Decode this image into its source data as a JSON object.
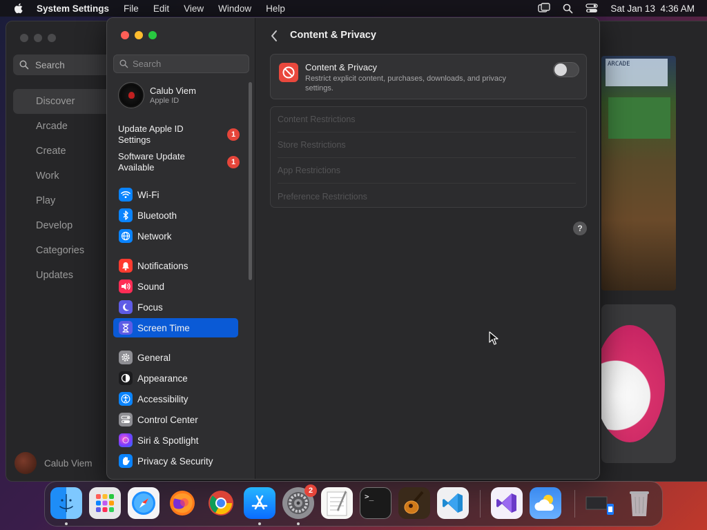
{
  "menubar": {
    "app_name": "System Settings",
    "menus": [
      "File",
      "Edit",
      "View",
      "Window",
      "Help"
    ],
    "datetime": "Sat Jan 13  4:36 AM"
  },
  "appstore": {
    "search_placeholder": "Search",
    "nav": [
      "Discover",
      "Arcade",
      "Create",
      "Work",
      "Play",
      "Develop",
      "Categories",
      "Updates"
    ],
    "active_nav": "Discover",
    "user_name": "Calub Viem",
    "art_sign": "ARCADE"
  },
  "settings": {
    "search_placeholder": "Search",
    "profile": {
      "name": "Calub Viem",
      "subtitle": "Apple ID"
    },
    "alerts": [
      {
        "label_line1": "Update Apple ID",
        "label_line2": "Settings",
        "count": "1"
      },
      {
        "label_line1": "Software Update",
        "label_line2": "Available",
        "count": "1"
      }
    ],
    "groups": [
      [
        {
          "label": "Wi-Fi",
          "icon": "wifi-icon",
          "color": "#0a84ff"
        },
        {
          "label": "Bluetooth",
          "icon": "bluetooth-icon",
          "color": "#0a84ff"
        },
        {
          "label": "Network",
          "icon": "globe-icon",
          "color": "#0a84ff"
        }
      ],
      [
        {
          "label": "Notifications",
          "icon": "bell-icon",
          "color": "#ff3b30"
        },
        {
          "label": "Sound",
          "icon": "speaker-icon",
          "color": "#ff2d55"
        },
        {
          "label": "Focus",
          "icon": "moon-icon",
          "color": "#5e5ce6"
        },
        {
          "label": "Screen Time",
          "icon": "hourglass-icon",
          "color": "#5e5ce6",
          "selected": true
        }
      ],
      [
        {
          "label": "General",
          "icon": "gear-icon",
          "color": "#8e8e93"
        },
        {
          "label": "Appearance",
          "icon": "appearance-icon",
          "color": "#1c1c1e"
        },
        {
          "label": "Accessibility",
          "icon": "accessibility-icon",
          "color": "#0a84ff"
        },
        {
          "label": "Control Center",
          "icon": "toggles-icon",
          "color": "#8e8e93"
        },
        {
          "label": "Siri & Spotlight",
          "icon": "siri-icon",
          "color": "#bf5af2"
        },
        {
          "label": "Privacy & Security",
          "icon": "hand-icon",
          "color": "#0a84ff"
        }
      ]
    ],
    "content": {
      "title": "Content & Privacy",
      "card": {
        "heading": "Content & Privacy",
        "description": "Restrict explicit content, purchases, downloads, and privacy settings.",
        "toggle_on": false
      },
      "restrictions": [
        "Content Restrictions",
        "Store Restrictions",
        "App Restrictions",
        "Preference Restrictions"
      ],
      "help_label": "?"
    }
  },
  "dock": {
    "apps": [
      {
        "name": "Finder",
        "icon": "finder-icon",
        "running": true
      },
      {
        "name": "Launchpad",
        "icon": "launchpad-icon",
        "running": false
      },
      {
        "name": "Safari",
        "icon": "safari-icon",
        "running": false
      },
      {
        "name": "Firefox",
        "icon": "firefox-icon",
        "running": false
      },
      {
        "name": "Chrome",
        "icon": "chrome-icon",
        "running": false
      },
      {
        "name": "App Store",
        "icon": "app-store-icon",
        "running": true
      },
      {
        "name": "System Settings",
        "icon": "system-settings-icon",
        "running": true,
        "badge": "2"
      },
      {
        "name": "TextEdit",
        "icon": "textedit-icon",
        "running": false
      },
      {
        "name": "Terminal",
        "icon": "terminal-icon",
        "running": false
      },
      {
        "name": "GarageBand",
        "icon": "garageband-icon",
        "running": false
      },
      {
        "name": "VS Code",
        "icon": "vscode-icon",
        "running": false
      },
      {
        "name": "Visual Studio",
        "icon": "visual-studio-icon",
        "running": false
      },
      {
        "name": "Weather",
        "icon": "weather-icon",
        "running": false
      },
      {
        "name": "Downloads",
        "icon": "downloads-stack-icon",
        "running": false
      },
      {
        "name": "Trash",
        "icon": "trash-icon",
        "running": false
      }
    ],
    "terminal_prompt": ">_"
  }
}
